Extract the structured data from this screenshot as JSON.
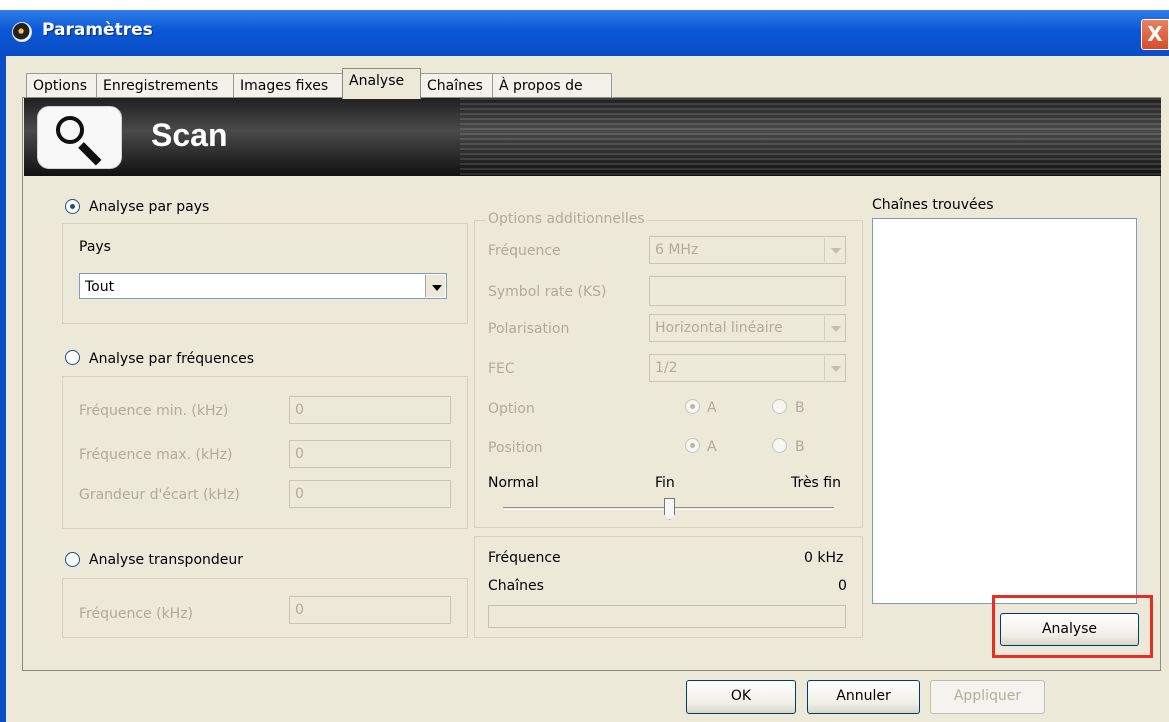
{
  "window": {
    "title": "Paramètres",
    "close_glyph": "X"
  },
  "tabs": [
    {
      "label": "Options"
    },
    {
      "label": "Enregistrements"
    },
    {
      "label": "Images fixes"
    },
    {
      "label": "Analyse"
    },
    {
      "label": "Chaînes"
    },
    {
      "label": "À propos de"
    }
  ],
  "banner": {
    "title": "Scan",
    "icon": "magnifier-icon"
  },
  "country_scan": {
    "radio_label": "Analyse par pays",
    "group_label": "Pays",
    "selected_country": "Tout"
  },
  "frequency_scan": {
    "radio_label": "Analyse par fréquences",
    "min_label": "Fréquence min. (kHz)",
    "min_value": "0",
    "max_label": "Fréquence max. (kHz)",
    "max_value": "0",
    "step_label": "Grandeur d'écart (kHz)",
    "step_value": "0"
  },
  "transponder_scan": {
    "radio_label": "Analyse transpondeur",
    "frequency_label": "Fréquence (kHz)",
    "frequency_value": "0"
  },
  "options": {
    "group_label": "Options additionnelles",
    "frequency_label": "Fréquence",
    "frequency_value": "6 MHz",
    "symbol_rate_label": "Symbol rate (KS)",
    "symbol_rate_value": "",
    "polarization_label": "Polarisation",
    "polarization_value": "Horizontal linéaire",
    "fec_label": "FEC",
    "fec_value": "1/2",
    "option_label": "Option",
    "option_a": "A",
    "option_b": "B",
    "position_label": "Position",
    "position_a": "A",
    "position_b": "B",
    "slider_normal": "Normal",
    "slider_fine": "Fin",
    "slider_very_fine": "Très fin",
    "slider_position": "middle"
  },
  "status": {
    "frequency_label": "Fréquence",
    "frequency_value": "0 kHz",
    "channels_label": "Chaînes",
    "channels_value": "0"
  },
  "found_channels": {
    "label": "Chaînes trouvées",
    "items": []
  },
  "buttons": {
    "analyse": "Analyse",
    "ok": "OK",
    "cancel": "Annuler",
    "apply": "Appliquer"
  },
  "colors": {
    "titlebar_blue": "#0a57d6",
    "highlight_red": "#e52f25",
    "xp_background": "#ece9d8"
  }
}
